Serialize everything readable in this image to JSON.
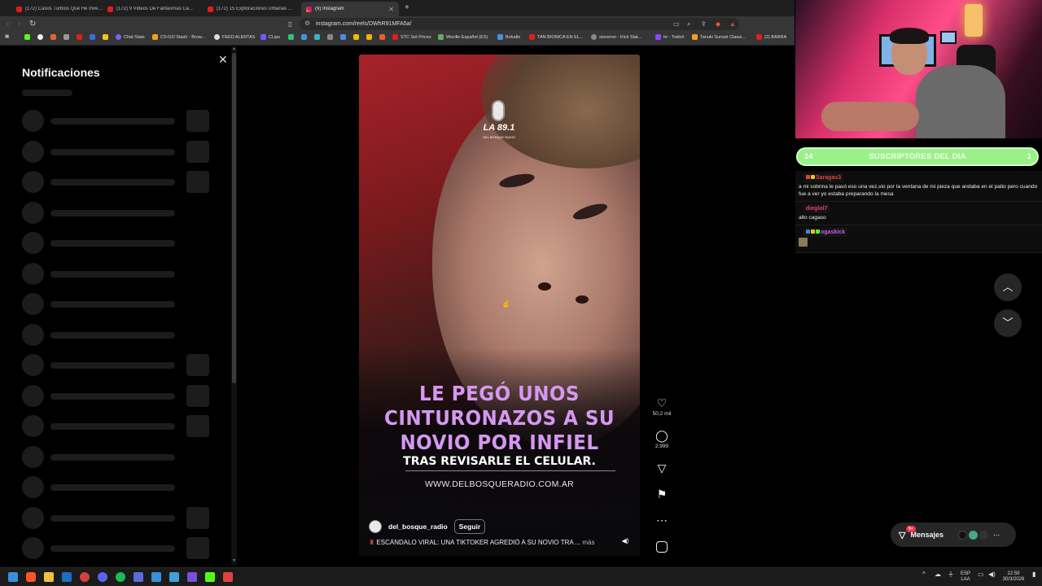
{
  "browser": {
    "tabs": [
      {
        "title": "(172) Casos Turbios Que He Investig...",
        "active": false,
        "icon": "youtube-icon"
      },
      {
        "title": "(172) 9 Videos De Fantasmas Captad...",
        "active": false,
        "icon": "youtube-icon"
      },
      {
        "title": "(172) 15 Exploraciones Urbanas Que...",
        "active": false,
        "icon": "youtube-icon"
      },
      {
        "title": "(9) Instagram",
        "active": true,
        "icon": "instagram-icon"
      }
    ],
    "url": "instagram.com/reels/DWhR91MFA5a/",
    "bookmarks": [
      "Chat Stats",
      "CS:GO Stash - Brow...",
      "FEED ALERTAS",
      "CLips",
      "STC Set Prices",
      "Wordle Español (ES)",
      "Boludle",
      "TAN BIONICA EN EL...",
      "sioneron - Kick Stat...",
      "trr - Twitch",
      "Tanuki Sunset Classi...",
      "(2) BARRA"
    ]
  },
  "notifications": {
    "title": "Notificaciones"
  },
  "reel": {
    "logo_text": "LA 89.1",
    "logo_sub": "DEL BOSQUE RADIO",
    "headline": [
      "LE PEGÓ UNOS",
      "CINTURONAZOS A SU",
      "NOVIO POR INFIEL"
    ],
    "subline": "TRAS REVISARLE EL CELULAR.",
    "website": "WWW.DELBOSQUERADIO.COM.AR",
    "username": "del_bosque_radio",
    "follow_label": "Seguir",
    "caption": "ESCÁNDALO VIRAL: UNA TIKTOKER AGREDIÓ A SU NOVIO TRA ...",
    "more_label": "más"
  },
  "actions": {
    "likes": "50,2 mil",
    "comments": "2.999"
  },
  "messages": {
    "label": "Mensajes",
    "badge": "9+"
  },
  "overlay": {
    "subs_left": "14",
    "subs_title": "SUSCRIPTORES DEL DIA",
    "subs_right": "1",
    "chat": [
      {
        "user": "Saragas3",
        "color": "#e0453a",
        "text": "a mi sobrina le pasó eso una vez,vio por la ventana de mi pieza que andaba en el patio pero cuando fue a ver yo estaba preparando la mesa"
      },
      {
        "user": "dieglol7",
        "color": "#e04060",
        "text": "alto cagaso"
      },
      {
        "user": "ogaskick",
        "color": "#c05cf0",
        "text": ""
      }
    ]
  },
  "taskbar": {
    "lang_top": "ESP",
    "lang_bottom": "LAA",
    "time": "22:59",
    "date": "30/3/2026"
  },
  "colors": {
    "headline": "#d598f0",
    "subs_bar": "#9cf08a",
    "messages_badge": "#ff3040"
  }
}
